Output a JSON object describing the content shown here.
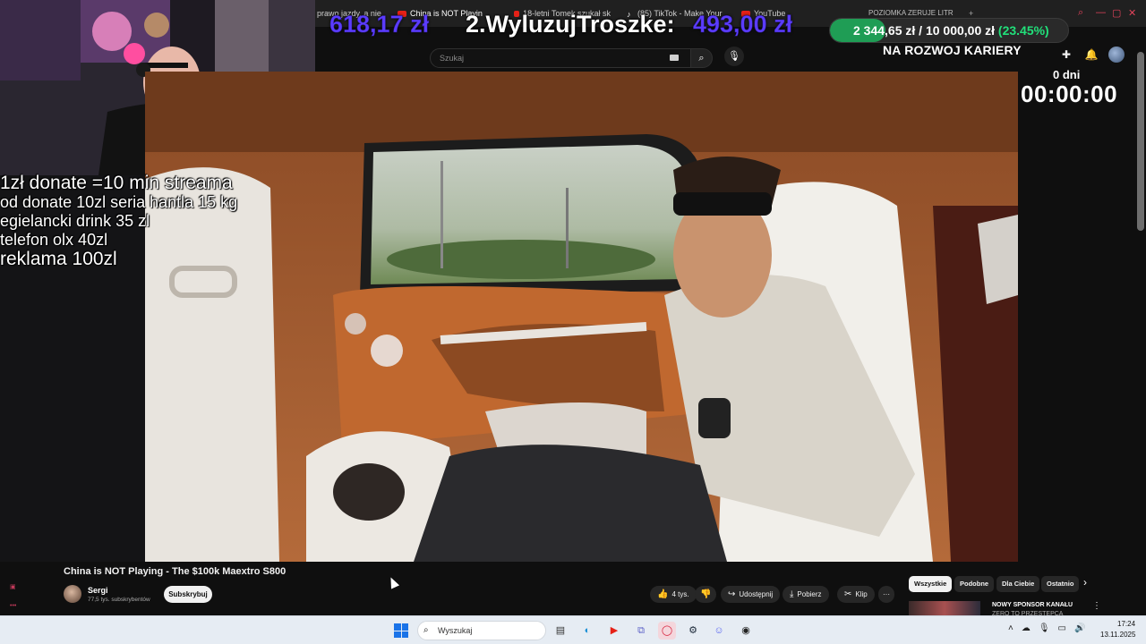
{
  "browser": {
    "tabs": [
      {
        "label": "prawo jazdy, a nie",
        "kind": "text"
      },
      {
        "label": "China is NOT Playin",
        "kind": "youtube",
        "active": true
      },
      {
        "label": "18-letni Tomek szukał sk",
        "kind": "youtube"
      },
      {
        "label": "(85) TikTok - Make Your",
        "kind": "tiktok"
      },
      {
        "label": "YouTube",
        "kind": "youtube"
      },
      {
        "label": "POZIOMKA ZERUJE LITR",
        "kind": "youtube"
      }
    ],
    "new_tab": "+"
  },
  "donation_ranking": {
    "first_amount": "618,17 zł",
    "second_label": "2.WyluzujTroszke:",
    "second_amount": "493,00 zł"
  },
  "goal": {
    "label": "POZIOMKA ZERUJE LITR",
    "text": "2 344,65 zł / 10 000,00 zł",
    "percent_text": "(23.45%)",
    "fraction": 0.2345
  },
  "youtube": {
    "search_placeholder": "Szukaj",
    "career_text": "NA ROZWOJ KARIERY",
    "icons": [
      "create-icon",
      "bell-icon",
      "avatar"
    ]
  },
  "timer": {
    "days": "0 dni",
    "time": "00:00:00"
  },
  "rules": [
    "1zł donate =10 min streama",
    "od donate 10zl seria hantla 15 kg",
    "egielancki drink 35 zl",
    "telefon olx 40zl",
    "reklama 100zl"
  ],
  "video": {
    "title": "China is NOT Playing - The $100k Maextro S800",
    "channel": "Sergi",
    "subscribers": "77,5 tys. subskrybentów",
    "subscribe_label": "Subskrybuj",
    "likes": "4 tys.",
    "share_label": "Udostępnij",
    "download_label": "Pobierz",
    "clip_label": "Klip",
    "more_label": "···"
  },
  "chips": [
    "Wszystkie",
    "Podobne",
    "Dla Ciebie",
    "Ostatnio"
  ],
  "sponsor": {
    "title": "NOWY SPONSOR KANAŁU",
    "subtitle": "ZERO TO PRZESTĘPCA"
  },
  "taskbar": {
    "search_placeholder": "Wyszukaj",
    "time": "17:24",
    "date": "13.11.2025",
    "apps": [
      "file-explorer-icon",
      "edge-icon",
      "youtube-app-icon",
      "snipping-icon",
      "opera-icon",
      "steam-icon",
      "discord-icon",
      "app-icon"
    ]
  },
  "colors": {
    "goal_fill": "#1f9d55",
    "goal_percent": "#21e07a",
    "dono_amount": "#5b3cff",
    "youtube_red": "#e62117"
  }
}
